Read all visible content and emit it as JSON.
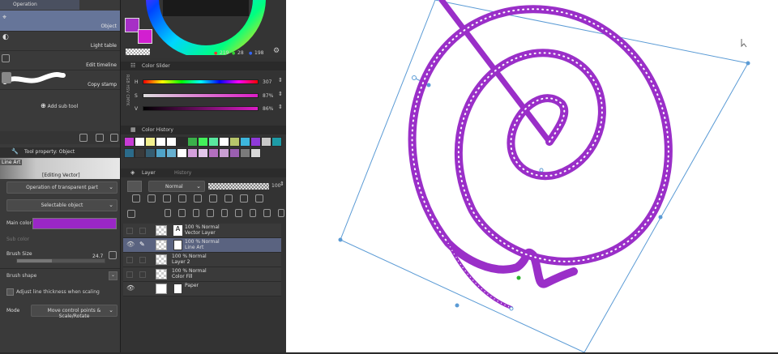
{
  "subtool": {
    "header": "Operation",
    "items": [
      {
        "label": "Object"
      },
      {
        "label": "Light table"
      },
      {
        "label": "Edit timeline"
      },
      {
        "label": "Copy stamp"
      }
    ],
    "add_sub_tool": "Add sub tool"
  },
  "tool_property": {
    "header": "Tool property: Object",
    "line_art_tag": "Line Art",
    "editing_label": "[Editing Vector]",
    "transparent_op": "Operation of transparent part",
    "selectable": "Selectable object",
    "main_color_label": "Main color",
    "main_color": "#9a27c6",
    "sub_color_label": "Sub color",
    "brush_size_label": "Brush Size",
    "brush_size_value": "24.7",
    "brush_shape_label": "Brush shape",
    "adjust_line_label": "Adjust line thickness when scaling",
    "mode_label": "Mode",
    "mode_value": "Move control points & Scale/Rotate"
  },
  "color_wheel": {
    "r": "219",
    "g": "28",
    "b": "198",
    "main_swatch": "#a62fc6",
    "sub_swatch": "#d21fd0"
  },
  "color_slider": {
    "tab": "Color Slider",
    "side_tabs": [
      "RGB",
      "HSV",
      "CMYK"
    ],
    "h_label": "H",
    "h_value": "307",
    "s_label": "S",
    "s_value": "87%",
    "v_label": "V",
    "v_value": "86%"
  },
  "color_history": {
    "tab": "Color History",
    "colors": [
      "#c83bd6",
      "#ffffff",
      "#f2ef8f",
      "#ffffff",
      "#ffffff",
      "#2a2a2a",
      "#3aaf4a",
      "#42f05a",
      "#59e8a0",
      "#ffffff",
      "#b7c56b",
      "#3db6dd",
      "#8e3ad8",
      "#c8c8c8",
      "#1d9ba6",
      "#2b6b8a",
      "#3a3a3a",
      "#355c70",
      "#4fa3c8",
      "#66b0d0",
      "#ffffff",
      "#d4a0dc",
      "#e2c6ea",
      "#b36fbf",
      "#c99fd3",
      "#9a5fb0",
      "#7a7a7a",
      "#d8d8d8"
    ]
  },
  "layer_panel": {
    "tab_layer": "Layer",
    "tab_history": "History",
    "blend_mode": "Normal",
    "opacity": "100",
    "layers": [
      {
        "line1": "100 % Normal",
        "line2": "Vector Layer"
      },
      {
        "line1": "100 % Normal",
        "line2": "Line Art"
      },
      {
        "line1": "100 % Normal",
        "line2": "Layer 2"
      },
      {
        "line1": "100 % Normal",
        "line2": "Color Fill"
      },
      {
        "line1": "",
        "line2": "Paper"
      }
    ]
  },
  "canvas": {
    "stroke_color": "#9a2fc8"
  }
}
